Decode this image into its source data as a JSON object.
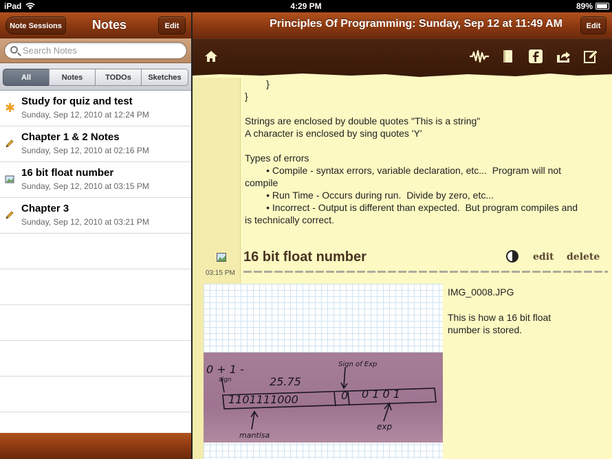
{
  "status": {
    "device": "iPad",
    "time": "4:29 PM",
    "battery": "89%"
  },
  "left": {
    "back_label": "Note Sessions",
    "title": "Notes",
    "edit_label": "Edit",
    "search_placeholder": "Search Notes",
    "segments": [
      "All",
      "Notes",
      "TODOs",
      "Sketches"
    ],
    "selected_segment": "All",
    "notes": [
      {
        "title": "Study for quiz and test",
        "date": "Sunday, Sep 12, 2010 at 12:24 PM",
        "icon": "asterisk-icon"
      },
      {
        "title": "Chapter 1 & 2 Notes",
        "date": "Sunday, Sep 12, 2010 at 02:16 PM",
        "icon": "pencil-icon"
      },
      {
        "title": "16 bit float number",
        "date": "Sunday, Sep 12, 2010 at 03:15 PM",
        "icon": "sketch-icon"
      },
      {
        "title": "Chapter 3",
        "date": "Sunday, Sep 12, 2010 at 03:21 PM",
        "icon": "pencil-icon"
      }
    ]
  },
  "right": {
    "title": "Principles Of Programming: Sunday, Sep 12 at 11:49 AM",
    "edit_label": "Edit",
    "toolbar_icons": [
      "home-icon",
      "record-audio-icon",
      "book-icon",
      "facebook-icon",
      "share-icon",
      "compose-icon"
    ],
    "body_lines": [
      "        }",
      "}",
      "",
      "Strings are enclosed by double quotes \"This is a string\"",
      "A character is enclosed by sing quotes 'Y'",
      "",
      "Types of errors",
      "        • Compile - syntax errors, variable declaration, etc...  Program will not",
      "compile",
      "        • Run Time - Occurs during run.  Divide by zero, etc...",
      "        • Incorrect - Output is different than expected.  But program compiles and",
      "is technically correct."
    ],
    "section": {
      "title": "16 bit float number",
      "time": "03:15 PM",
      "edit_label": "edit",
      "delete_label": "delete",
      "image_name": "IMG_0008.JPG",
      "image_desc": "This is how a 16 bit float\nnumber is stored.",
      "handwriting": {
        "top_formula": "0 + 1 -",
        "sign": "sign",
        "value": "25.75",
        "sign_exp": "Sign of Exp",
        "mantissa_bits": "1101111000",
        "sign_bit": "0",
        "exp_bits": "0 1 0 1",
        "mantissa_label": "mantisa",
        "exp_label": "exp"
      }
    }
  },
  "colors": {
    "wood": "#8e3a12",
    "paper": "#fcf9c2",
    "toolbar": "#3a1a08"
  }
}
